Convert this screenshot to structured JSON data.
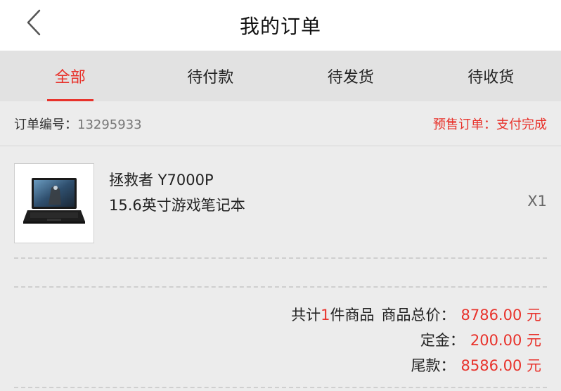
{
  "nav": {
    "title": "我的订单"
  },
  "tabs": [
    {
      "label": "全部",
      "active": true
    },
    {
      "label": "待付款",
      "active": false
    },
    {
      "label": "待发货",
      "active": false
    },
    {
      "label": "待收货",
      "active": false
    }
  ],
  "order": {
    "number_label": "订单编号：",
    "number_value": "13295933",
    "status": "预售订单：支付完成"
  },
  "product": {
    "name_line1": "拯救者 Y7000P",
    "name_line2": "15.6英寸游戏笔记本",
    "quantity": "X1"
  },
  "summary": {
    "count_prefix": "共计",
    "count_value": "1",
    "count_suffix": "件商品",
    "total_label": "商品总价：",
    "total_value": "8786.00 元",
    "deposit_label": "定金：",
    "deposit_value": "200.00 元",
    "balance_label": "尾款：",
    "balance_value": "8586.00 元"
  },
  "colors": {
    "accent": "#e8322b",
    "background": "#ececec",
    "tab_bar": "#e2e2e2"
  }
}
